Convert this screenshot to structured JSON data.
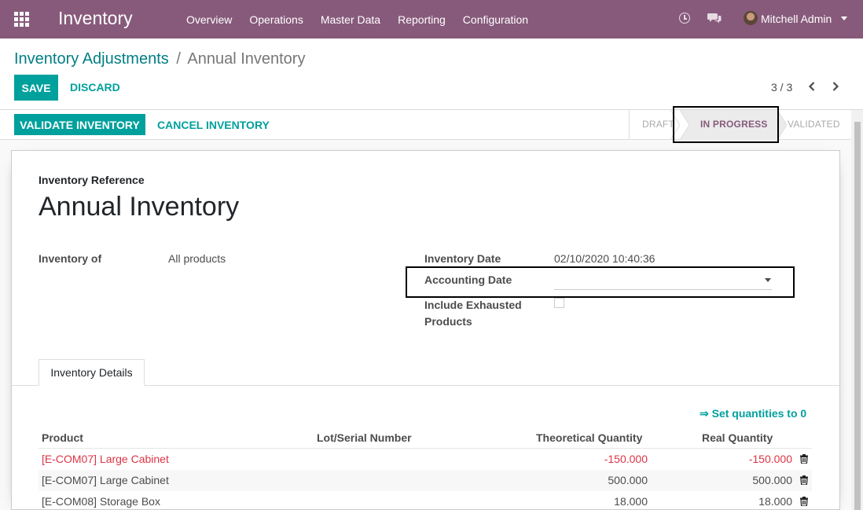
{
  "navbar": {
    "app_name": "Inventory",
    "menu": [
      "Overview",
      "Operations",
      "Master Data",
      "Reporting",
      "Configuration"
    ],
    "user_name": "Mitchell Admin",
    "icons": [
      "apps-icon",
      "clock-icon",
      "chat-icon"
    ]
  },
  "breadcrumb": {
    "parent": "Inventory Adjustments",
    "separator": "/",
    "current": "Annual Inventory"
  },
  "toolbar": {
    "save_label": "SAVE",
    "discard_label": "DISCARD",
    "pager": "3 / 3"
  },
  "statusbar": {
    "validate_label": "VALIDATE INVENTORY",
    "cancel_label": "CANCEL INVENTORY",
    "steps": [
      "DRAFT",
      "IN PROGRESS",
      "VALIDATED"
    ],
    "active_step": "IN PROGRESS"
  },
  "form": {
    "reference_label": "Inventory Reference",
    "reference_value": "Annual Inventory",
    "inventory_of_label": "Inventory of",
    "inventory_of_value": "All products",
    "inventory_date_label": "Inventory Date",
    "inventory_date_value": "02/10/2020 10:40:36",
    "accounting_date_label": "Accounting Date",
    "accounting_date_value": "",
    "include_exhausted_label": "Include Exhausted Products",
    "include_exhausted_checked": false
  },
  "notebook": {
    "tab_label": "Inventory Details",
    "set_quantities_label": "⇒ Set quantities to 0"
  },
  "table": {
    "columns": [
      "Product",
      "Lot/Serial Number",
      "Theoretical Quantity",
      "Real Quantity"
    ],
    "rows": [
      {
        "product": "[E-COM07] Large Cabinet",
        "lot": "",
        "theoretical": "-150.000",
        "real": "-150.000",
        "negative": true
      },
      {
        "product": "[E-COM07] Large Cabinet",
        "lot": "",
        "theoretical": "500.000",
        "real": "500.000",
        "negative": false
      },
      {
        "product": "[E-COM08] Storage Box",
        "lot": "",
        "theoretical": "18.000",
        "real": "18.000",
        "negative": false
      }
    ]
  },
  "colors": {
    "navbar": "#875a7b",
    "primary": "#00a09d",
    "link": "#017e84",
    "danger": "#dc3545"
  }
}
